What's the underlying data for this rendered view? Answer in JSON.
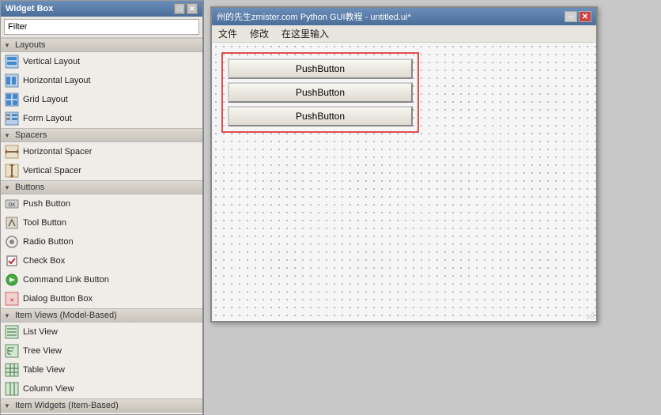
{
  "widgetBox": {
    "title": "Widget Box",
    "filterPlaceholder": "Filter",
    "filterValue": "Filter",
    "titleButtons": {
      "restore": "□",
      "close": "✕"
    },
    "sections": [
      {
        "id": "layouts",
        "label": "Layouts",
        "items": [
          {
            "id": "vertical-layout",
            "label": "Vertical Layout",
            "iconType": "vl"
          },
          {
            "id": "horizontal-layout",
            "label": "Horizontal Layout",
            "iconType": "hl"
          },
          {
            "id": "grid-layout",
            "label": "Grid Layout",
            "iconType": "gl"
          },
          {
            "id": "form-layout",
            "label": "Form Layout",
            "iconType": "fl"
          }
        ]
      },
      {
        "id": "spacers",
        "label": "Spacers",
        "items": [
          {
            "id": "horizontal-spacer",
            "label": "Horizontal Spacer",
            "iconType": "hs"
          },
          {
            "id": "vertical-spacer",
            "label": "Vertical Spacer",
            "iconType": "vs"
          }
        ]
      },
      {
        "id": "buttons",
        "label": "Buttons",
        "items": [
          {
            "id": "push-button",
            "label": "Push Button",
            "iconType": "pb"
          },
          {
            "id": "tool-button",
            "label": "Tool Button",
            "iconType": "tb"
          },
          {
            "id": "radio-button",
            "label": "Radio Button",
            "iconType": "rb"
          },
          {
            "id": "check-box",
            "label": "Check Box",
            "iconType": "cb"
          },
          {
            "id": "command-link-button",
            "label": "Command Link Button",
            "iconType": "clb"
          },
          {
            "id": "dialog-button-box",
            "label": "Dialog Button Box",
            "iconType": "dbb"
          }
        ]
      },
      {
        "id": "item-views",
        "label": "Item Views (Model-Based)",
        "items": [
          {
            "id": "list-view",
            "label": "List View",
            "iconType": "lv"
          },
          {
            "id": "tree-view",
            "label": "Tree View",
            "iconType": "tv"
          },
          {
            "id": "table-view",
            "label": "Table View",
            "iconType": "tav"
          },
          {
            "id": "column-view",
            "label": "Column View",
            "iconType": "cv"
          }
        ]
      },
      {
        "id": "item-widgets",
        "label": "Item Widgets (Item-Based)",
        "items": []
      }
    ]
  },
  "designerWindow": {
    "title": "州的先生zmister.com Python GUI教程 - untitled.ui*",
    "menuItems": [
      "文件",
      "修改",
      "在这里输入"
    ],
    "buttons": {
      "minimize": "─",
      "close": "✕"
    },
    "pushButtons": [
      {
        "id": "btn1",
        "label": "PushButton"
      },
      {
        "id": "btn2",
        "label": "PushButton"
      },
      {
        "id": "btn3",
        "label": "PushButton"
      }
    ]
  }
}
